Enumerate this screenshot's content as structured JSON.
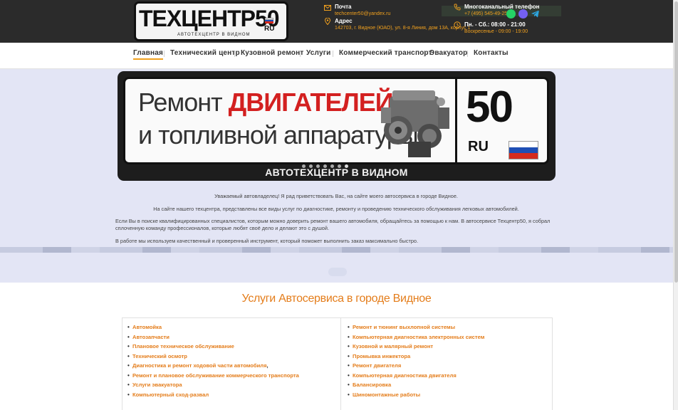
{
  "header": {
    "logo_text": "ТЕХЦЕНТР50",
    "logo_tagline": "АВТОТЕХЦЕНТР В ВИДНОМ",
    "logo_ru": "RU",
    "email_label": "Почта",
    "email_value": "techcenter50@yandex.ru",
    "address_label": "Адрес",
    "address_value": "142703, г. Видное (ЮАО), ул. 8-я Линия, дом 13А, корпус 1",
    "phone_label": "Многоканальный телефон",
    "phone_value": "+7 (495) 545-49-25",
    "hours_line1": "Пн. - Сб.: 08:00 - 21:00",
    "hours_line2": "Воскресенье - 09:00 - 19:00"
  },
  "nav": {
    "items": [
      {
        "label": "Главная"
      },
      {
        "label": "Технический центр"
      },
      {
        "label": "Кузовной ремонт"
      },
      {
        "label": "Услуги"
      },
      {
        "label": "Коммерческий транспорт"
      },
      {
        "label": "Эвакуатор"
      },
      {
        "label": "Контакты"
      }
    ]
  },
  "slider": {
    "line1_prefix": "Ремонт",
    "line1_highlight": "ДВИГАТЕЛЕЙ",
    "line2": "и топливной аппаратуры",
    "plate_number": "50",
    "plate_region": "RU",
    "bottom_text": "АВТОТЕХЦЕНТР В ВИДНОМ"
  },
  "intro": {
    "p1": "Уважаемый автовладелец! Я рад приветствовать Вас, на сайте моего автосервиса в городе Видное.",
    "p2": "На сайте нашего техцентра, представлены все виды услуг по диагностике, ремонту и проведению технического обслуживания легковых автомобилей.",
    "p3": "Если Вы в поиске квалифицированных специалистов, которым можно доверить ремонт вашего автомобиля, обращайтесь за помощью к нам. В автосервисе Техцентр50, я собрал сплоченную команду профессионалов, которые любят своё дело и делают это с душой.",
    "p4": "В работе мы используем качественный и проверенный инструмент, который поможет выполнить заказ максимально быстро."
  },
  "services": {
    "title": "Услуги Автосервиса в городе Видное",
    "left": [
      "Автомойка",
      "Автозапчасти",
      "Плановое техническое обслуживание",
      "Технический осмотр",
      "Диагностика и ремонт ходовой части автомобиля",
      "Ремонт и плановое обслуживание коммерческого транспорта",
      "Услуги эвакуатора",
      "Компьютерный сход-развал"
    ],
    "left_trailing": ",",
    "right": [
      "Ремонт и тюнинг выхлопной системы",
      "Компьютерная диагностика электронных систем",
      "Кузовной и малярный ремонт",
      "Промывка инжектора",
      "Ремонт двигателя",
      "Компьютерная  диагностика двигателя",
      "Балансировка",
      "Шиномонтажные работы"
    ]
  },
  "colors": {
    "accent": "#e47d1b",
    "header_bg": "#2b2b2b",
    "hero_bg": "#e3e5f5",
    "highlight_red": "#d32020"
  }
}
